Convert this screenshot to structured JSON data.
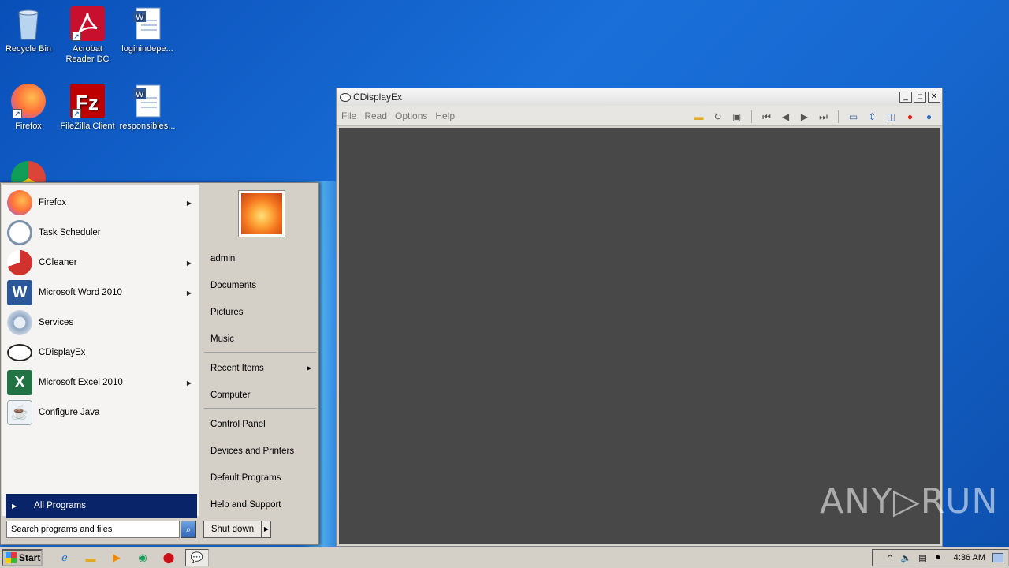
{
  "desktop": {
    "icons": [
      {
        "label": "Recycle Bin",
        "icon": "recycle-bin-icon"
      },
      {
        "label": "Acrobat Reader DC",
        "icon": "acrobat-icon"
      },
      {
        "label": "loginindepe...",
        "icon": "word-doc-icon"
      },
      {
        "label": "Firefox",
        "icon": "firefox-icon"
      },
      {
        "label": "FileZilla Client",
        "icon": "filezilla-icon"
      },
      {
        "label": "responsibles...",
        "icon": "word-doc-icon"
      }
    ]
  },
  "window": {
    "title": "CDisplayEx",
    "menu": [
      "File",
      "Read",
      "Options",
      "Help"
    ],
    "controls": {
      "minimize": "_",
      "maximize": "□",
      "close": "✕"
    }
  },
  "start_menu": {
    "programs": [
      {
        "label": "Firefox",
        "submenu": true,
        "color": "#e66000"
      },
      {
        "label": "Task Scheduler",
        "submenu": false,
        "color": "#9ab0c8"
      },
      {
        "label": "CCleaner",
        "submenu": true,
        "color": "#d2322d"
      },
      {
        "label": "Microsoft Word 2010",
        "submenu": true,
        "color": "#2b579a"
      },
      {
        "label": "Services",
        "submenu": false,
        "color": "#8fa5c0"
      },
      {
        "label": "CDisplayEx",
        "submenu": false,
        "color": "#ffffff"
      },
      {
        "label": "Microsoft Excel 2010",
        "submenu": true,
        "color": "#217346"
      },
      {
        "label": "Configure Java",
        "submenu": false,
        "color": "#5382a1"
      }
    ],
    "all_programs": "All Programs",
    "search_placeholder": "Search programs and files",
    "right_links": {
      "user": "admin",
      "documents": "Documents",
      "pictures": "Pictures",
      "music": "Music",
      "recent": "Recent Items",
      "computer": "Computer",
      "control_panel": "Control Panel",
      "devices": "Devices and Printers",
      "default_programs": "Default Programs",
      "help": "Help and Support"
    },
    "shutdown": "Shut down"
  },
  "taskbar": {
    "start": "Start",
    "clock": "4:36 AM"
  },
  "watermark": "ANY▷RUN"
}
